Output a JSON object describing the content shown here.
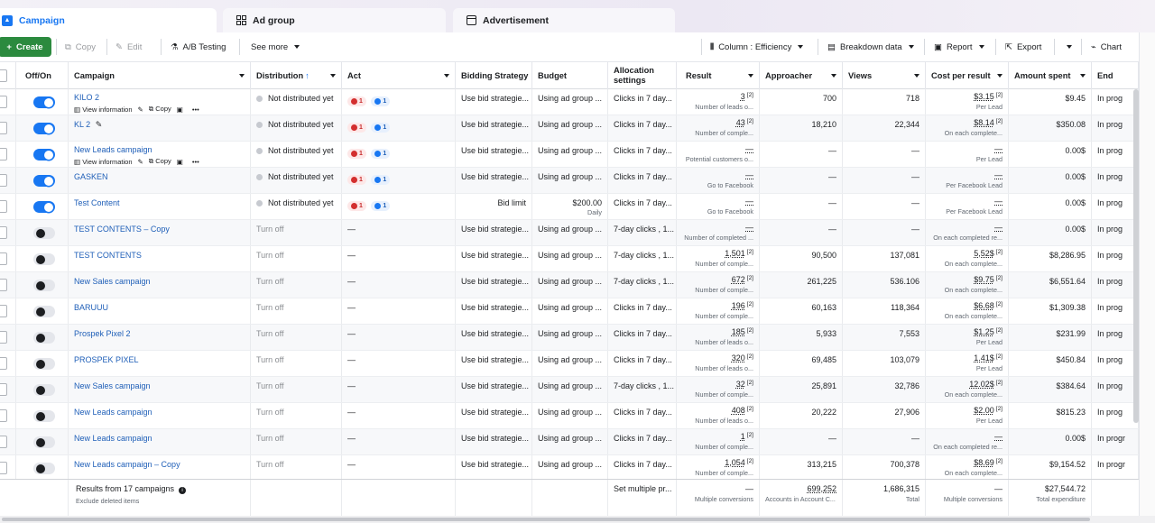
{
  "tabs": [
    {
      "label": "Campaign",
      "active": true,
      "icon": "campaign-icon"
    },
    {
      "label": "Ad group",
      "active": false,
      "icon": "grid-icon"
    },
    {
      "label": "Advertisement",
      "active": false,
      "icon": "ad-icon"
    }
  ],
  "toolbar": {
    "create": "Create",
    "copy": "Copy",
    "edit": "Edit",
    "ab_testing": "A/B Testing",
    "see_more": "See more",
    "column": "Column : Efficiency",
    "breakdown": "Breakdown data",
    "report": "Report",
    "export": "Export",
    "chart": "Chart"
  },
  "columns": {
    "off_on": "Off/On",
    "campaign": "Campaign",
    "distribution": "Distribution",
    "act": "Act",
    "bidding": "Bidding Strategy",
    "budget": "Budget",
    "allocation": "Allocation settings",
    "result": "Result",
    "approacher": "Approacher",
    "views": "Views",
    "cost": "Cost per result",
    "spent": "Amount spent",
    "end": "End"
  },
  "row_actions": {
    "view": "View information",
    "copy": "Copy"
  },
  "rows": [
    {
      "on": true,
      "name": "KILO 2",
      "actions": true,
      "dist": "Not distributed yet",
      "dist_active": true,
      "act": [
        "1",
        "1"
      ],
      "bid": "Use bid strategie...",
      "budget": "Using ad group ...",
      "budget_sub": "",
      "alloc": "Clicks in 7 day...",
      "result": "3",
      "result_sub": "Number of leads o...",
      "approacher": "700",
      "views": "718",
      "cost": "$3.15",
      "cost_sub": "Per Lead",
      "spent": "$9.45",
      "end": "In prog"
    },
    {
      "on": true,
      "name": "KL 2",
      "actions": false,
      "pencil": true,
      "dist": "Not distributed yet",
      "dist_active": true,
      "act": [
        "1",
        "1"
      ],
      "bid": "Use bid strategie...",
      "budget": "Using ad group ...",
      "budget_sub": "",
      "alloc": "Clicks in 7 day...",
      "result": "43",
      "result_sub": "Number of comple...",
      "approacher": "18,210",
      "views": "22,344",
      "cost": "$8.14",
      "cost_sub": "On each complete...",
      "spent": "$350.08",
      "end": "In prog"
    },
    {
      "on": true,
      "name": "New Leads campaign",
      "actions": true,
      "dist": "Not distributed yet",
      "dist_active": true,
      "act": [
        "1",
        "1"
      ],
      "bid": "Use bid strategie...",
      "budget": "Using ad group ...",
      "budget_sub": "",
      "alloc": "Clicks in 7 day...",
      "result": "—",
      "result_sub": "Potential customers o...",
      "approacher": "—",
      "views": "—",
      "cost": "—",
      "cost_sub": "Per Lead",
      "spent": "0.00$",
      "end": "In prog"
    },
    {
      "on": true,
      "name": "GASKEN",
      "actions": false,
      "dist": "Not distributed yet",
      "dist_active": true,
      "act": [
        "1",
        "1"
      ],
      "bid": "Use bid strategie...",
      "budget": "Using ad group ...",
      "budget_sub": "",
      "alloc": "Clicks in 7 day...",
      "result": "—",
      "result_sub": "Go to Facebook",
      "approacher": "—",
      "views": "—",
      "cost": "—",
      "cost_sub": "Per Facebook Lead",
      "spent": "0.00$",
      "end": "In prog"
    },
    {
      "on": true,
      "name": "Test Content",
      "actions": false,
      "dist": "Not distributed yet",
      "dist_active": true,
      "act": [
        "1",
        "1"
      ],
      "bid": "Bid limit",
      "bid_right": true,
      "budget": "$200.00",
      "budget_sub": "Daily",
      "budget_right": true,
      "alloc": "Clicks in 7 day...",
      "result": "—",
      "result_sub": "Go to Facebook",
      "approacher": "—",
      "views": "—",
      "cost": "—",
      "cost_sub": "Per Facebook Lead",
      "spent": "0.00$",
      "end": "In prog"
    },
    {
      "on": false,
      "name": "TEST CONTENTS – Copy",
      "actions": false,
      "dist": "Turn off",
      "dist_active": false,
      "act": [],
      "bid": "Use bid strategie...",
      "budget": "Using ad group ...",
      "budget_sub": "",
      "alloc": "7-day clicks , 1...",
      "result": "—",
      "result_sub": "Number of completed ...",
      "approacher": "—",
      "views": "—",
      "cost": "—",
      "cost_sub": "On each completed re...",
      "spent": "0.00$",
      "end": "In prog"
    },
    {
      "on": false,
      "name": "TEST CONTENTS",
      "actions": false,
      "dist": "Turn off",
      "dist_active": false,
      "act": [],
      "bid": "Use bid strategie...",
      "budget": "Using ad group ...",
      "budget_sub": "",
      "alloc": "7-day clicks , 1...",
      "result": "1,501",
      "result_sub": "Number of comple...",
      "approacher": "90,500",
      "views": "137,081",
      "cost": "5,52$",
      "cost_sub": "On each complete...",
      "spent": "$8,286.95",
      "end": "In prog"
    },
    {
      "on": false,
      "name": "New Sales campaign",
      "actions": false,
      "dist": "Turn off",
      "dist_active": false,
      "act": [],
      "bid": "Use bid strategie...",
      "budget": "Using ad group ...",
      "budget_sub": "",
      "alloc": "7-day clicks , 1...",
      "result": "672",
      "result_sub": "Number of comple...",
      "approacher": "261,225",
      "views": "536.106",
      "cost": "$9.75",
      "cost_sub": "On each complete...",
      "spent": "$6,551.64",
      "end": "In prog"
    },
    {
      "on": false,
      "name": "BARUUU",
      "actions": false,
      "dist": "Turn off",
      "dist_active": false,
      "act": [],
      "bid": "Use bid strategie...",
      "budget": "Using ad group ...",
      "budget_sub": "",
      "alloc": "Clicks in 7 day...",
      "result": "196",
      "result_sub": "Number of comple...",
      "approacher": "60,163",
      "views": "118,364",
      "cost": "$6.68",
      "cost_sub": "On each complete...",
      "spent": "$1,309.38",
      "end": "In prog"
    },
    {
      "on": false,
      "name": "Prospek Pixel 2",
      "actions": false,
      "dist": "Turn off",
      "dist_active": false,
      "act": [],
      "bid": "Use bid strategie...",
      "budget": "Using ad group ...",
      "budget_sub": "",
      "alloc": "Clicks in 7 day...",
      "result": "185",
      "result_sub": "Number of leads o...",
      "approacher": "5,933",
      "views": "7,553",
      "cost": "$1.25",
      "cost_sub": "Per Lead",
      "spent": "$231.99",
      "end": "In prog"
    },
    {
      "on": false,
      "name": "PROSPEK PIXEL",
      "actions": false,
      "dist": "Turn off",
      "dist_active": false,
      "act": [],
      "bid": "Use bid strategie...",
      "budget": "Using ad group ...",
      "budget_sub": "",
      "alloc": "Clicks in 7 day...",
      "result": "320",
      "result_sub": "Number of leads o...",
      "approacher": "69,485",
      "views": "103,079",
      "cost": "1.41$",
      "cost_sub": "Per Lead",
      "spent": "$450.84",
      "end": "In prog"
    },
    {
      "on": false,
      "name": "New Sales campaign",
      "actions": false,
      "dist": "Turn off",
      "dist_active": false,
      "act": [],
      "bid": "Use bid strategie...",
      "budget": "Using ad group ...",
      "budget_sub": "",
      "alloc": "7-day clicks , 1...",
      "result": "32",
      "result_sub": "Number of comple...",
      "approacher": "25,891",
      "views": "32,786",
      "cost": "12.02$",
      "cost_sub": "On each complete...",
      "spent": "$384.64",
      "end": "In prog"
    },
    {
      "on": false,
      "name": "New Leads campaign",
      "actions": false,
      "dist": "Turn off",
      "dist_active": false,
      "act": [],
      "bid": "Use bid strategie...",
      "budget": "Using ad group ...",
      "budget_sub": "",
      "alloc": "Clicks in 7 day...",
      "result": "408",
      "result_sub": "Number of leads o...",
      "approacher": "20,222",
      "views": "27,906",
      "cost": "$2.00",
      "cost_sub": "Per Lead",
      "spent": "$815.23",
      "end": "In prog"
    },
    {
      "on": false,
      "name": "New Leads campaign",
      "actions": false,
      "dist": "Turn off",
      "dist_active": false,
      "act": [],
      "bid": "Use bid strategie...",
      "budget": "Using ad group ...",
      "budget_sub": "",
      "alloc": "Clicks in 7 day...",
      "result": "1",
      "result_sub": "Number of comple...",
      "approacher": "—",
      "views": "—",
      "cost": "—",
      "cost_sub": "On each completed re...",
      "spent": "0.00$",
      "end": "In progr"
    },
    {
      "on": false,
      "name": "New Leads campaign – Copy",
      "actions": false,
      "dist": "Turn off",
      "dist_active": false,
      "act": [],
      "bid": "Use bid strategie...",
      "budget": "Using ad group ...",
      "budget_sub": "",
      "alloc": "Clicks in 7 day...",
      "result": "1,054",
      "result_sub": "Number of comple...",
      "approacher": "313,215",
      "views": "700,378",
      "cost": "$8.69",
      "cost_sub": "On each complete...",
      "spent": "$9,154.52",
      "end": "In progr"
    }
  ],
  "footer": {
    "results": "Results from 17 campaigns",
    "excluded": "Exclude deleted items",
    "alloc": "Set multiple pr...",
    "result": "—",
    "result_sub": "Multiple conversions",
    "approacher": "699,252",
    "approacher_sub": "Accounts in Account C...",
    "views": "1,686,315",
    "views_sub": "Total",
    "cost": "—",
    "cost_sub": "Multiple conversions",
    "spent": "$27,544.72",
    "spent_sub": "Total expenditure"
  },
  "colors": {
    "accent": "#1877f2",
    "create": "#2b8a3e",
    "link": "#1f5fb8"
  }
}
